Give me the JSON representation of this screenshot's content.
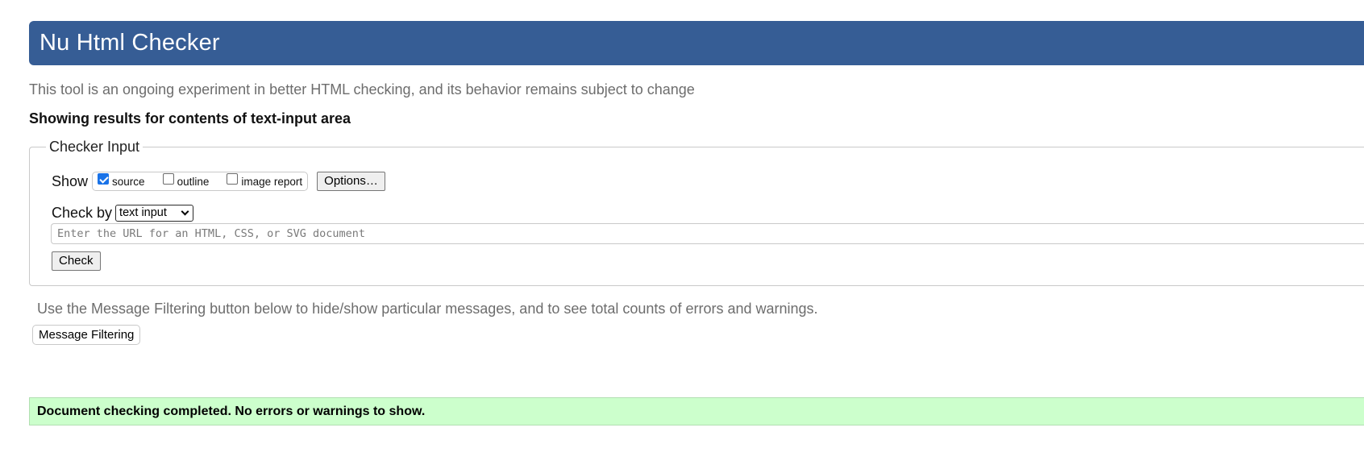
{
  "header": {
    "title": "Nu Html Checker"
  },
  "tagline": "This tool is an ongoing experiment in better HTML checking, and its behavior remains subject to change",
  "results_heading": "Showing results for contents of text-input area",
  "checker_input": {
    "legend": "Checker Input",
    "show_label": "Show",
    "show_options": [
      {
        "label": "source",
        "checked": true
      },
      {
        "label": "outline",
        "checked": false
      },
      {
        "label": "image report",
        "checked": false
      }
    ],
    "options_button": "Options…",
    "check_by_label": "Check by",
    "check_by_value": "text input",
    "url_placeholder": "Enter the URL for an HTML, CSS, or SVG document",
    "check_button": "Check"
  },
  "filtering": {
    "note": "Use the Message Filtering button below to hide/show particular messages, and to see total counts of errors and warnings.",
    "button": "Message Filtering"
  },
  "status": {
    "message": "Document checking completed. No errors or warnings to show.",
    "color": "#ccffcc"
  },
  "colors": {
    "header_bg": "#365d95",
    "checkbox_checked": "#1a73e8"
  }
}
